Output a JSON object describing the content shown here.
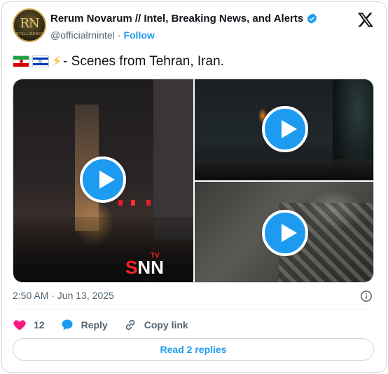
{
  "author": {
    "display_name": "Rerum Novarum // Intel, Breaking News, and Alerts",
    "handle": "@officialrnintel",
    "follow_label": "Follow",
    "avatar_monogram": "RN",
    "avatar_subtext": "INTELLIGENCE"
  },
  "tweet": {
    "text": "- Scenes from Tehran, Iran.",
    "emoji": [
      "iran-flag-icon",
      "israel-flag-icon",
      "lightning-icon"
    ]
  },
  "media": {
    "tiles": [
      {
        "type": "video",
        "label": "tehran-fire-street"
      },
      {
        "type": "video",
        "label": "tehran-night-flames"
      },
      {
        "type": "video",
        "label": "collapsed-building"
      }
    ],
    "watermark": {
      "s": "S",
      "nn": "NN",
      "tv": "TV"
    }
  },
  "meta": {
    "timestamp": "2:50 AM · Jun 13, 2025"
  },
  "actions": {
    "like_count": "12",
    "reply_label": "Reply",
    "copy_link_label": "Copy link"
  },
  "footer": {
    "read_replies_label": "Read 2 replies"
  },
  "colors": {
    "accent": "#1d9bf0",
    "like": "#f91880",
    "text_secondary": "#536471"
  }
}
